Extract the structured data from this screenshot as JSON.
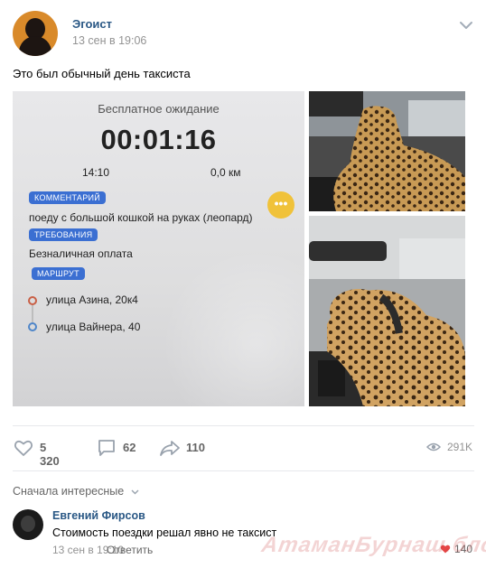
{
  "post": {
    "author": "Эгоист",
    "date": "13 сен в 19:06",
    "text": "Это был обычный день таксиста"
  },
  "taxi_screen": {
    "title": "Бесплатное ожидание",
    "timer": "00:01:16",
    "time": "14:10",
    "distance": "0,0 км",
    "tag_comment": "КОММЕНТАРИЙ",
    "comment": "поеду с большой кошкой на руках (леопард)",
    "tag_requirements": "ТРЕБОВАНИЯ",
    "requirement": "Безналичная оплата",
    "tag_route": "МАРШРУТ",
    "route_from": "улица Азина, 20к4",
    "route_to": "улица Вайнера, 40",
    "chat_icon": "ellipsis-chat-icon"
  },
  "actions": {
    "likes": "5 320",
    "comments": "62",
    "shares": "110",
    "views": "291K"
  },
  "comments_section": {
    "sort_label": "Сначала интересные",
    "items": [
      {
        "name": "Евгений Фирсов",
        "text": "Стоимость поездки решал явно не таксист",
        "date": "13 сен в 19:10",
        "reply_label": "Ответить",
        "likes": "140"
      }
    ]
  },
  "watermark": "АтаманБурнаш.блоПП",
  "colors": {
    "link": "#2a5885",
    "tag": "#3b6fd2",
    "muted": "#939393"
  }
}
